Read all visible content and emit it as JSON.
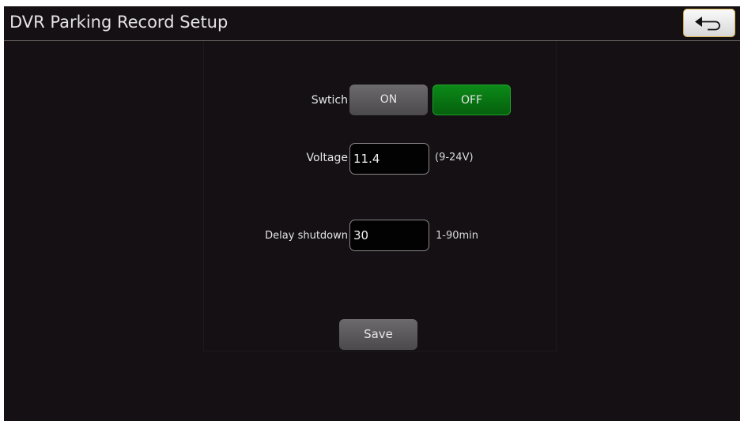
{
  "header": {
    "title": "DVR Parking Record Setup",
    "back_icon": "back-arrow-icon"
  },
  "form": {
    "switch": {
      "label": "Swtich",
      "on_label": "ON",
      "off_label": "OFF",
      "selected": "OFF",
      "selected_color": "#0b7a15"
    },
    "voltage": {
      "label": "Voltage",
      "value": "11.4",
      "unit": "(9-24V)"
    },
    "delay_shutdown": {
      "label": "Delay shutdown",
      "value": "30",
      "unit": "1-90min"
    },
    "save_label": "Save"
  },
  "colors": {
    "background": "#141013",
    "accent_border": "#d9b24a"
  }
}
